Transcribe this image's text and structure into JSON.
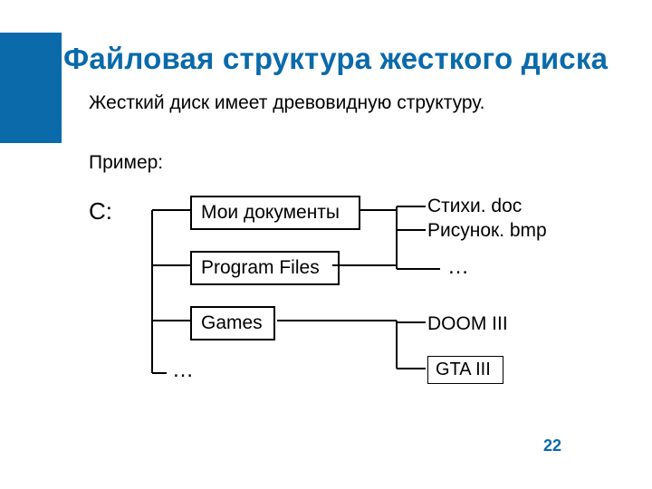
{
  "title": "Файловая структура жесткого диска",
  "subtitle": "Жесткий диск имеет древовидную структуру.",
  "example_label": "Пример:",
  "root_label": "C:",
  "nodes": {
    "my_docs": "Мои документы",
    "prog_files": "Program Files",
    "games": "Games",
    "ellipsis_left": "…",
    "stihi": "Стихи. doc",
    "risunok": "Рисунок. bmp",
    "ellipsis_right": "…",
    "doom": "DOOM III",
    "gta": "GTA III"
  },
  "page_number": "22"
}
